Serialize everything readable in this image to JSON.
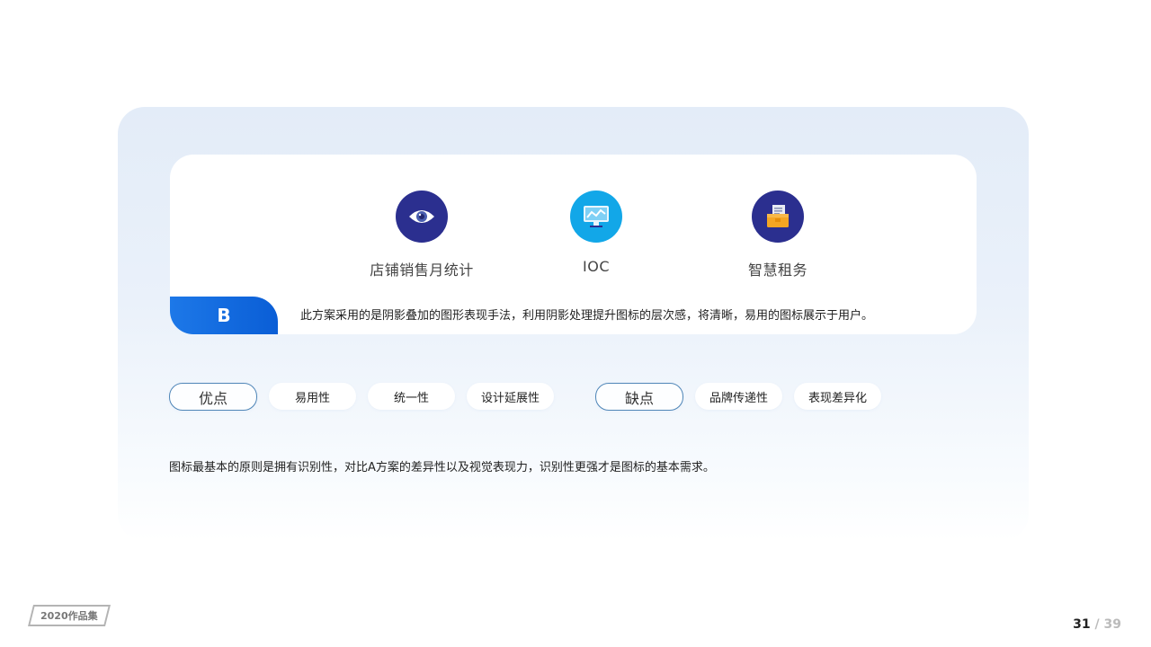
{
  "card": {
    "icons": [
      {
        "label": "店铺销售月统计",
        "icon": "eye-icon",
        "bg": "#2b2f8f"
      },
      {
        "label": "IOC",
        "icon": "monitor-chart-icon",
        "bg": "#12a7e8"
      },
      {
        "label": "智慧租务",
        "icon": "document-folder-icon",
        "bg": "#2b2f8f"
      }
    ],
    "badge": "B",
    "description": "此方案采用的是阴影叠加的图形表现手法，利用阴影处理提升图标的层次感，将清晰，易用的图标展示于用户。"
  },
  "pros": {
    "title": "优点",
    "items": [
      "易用性",
      "统一性",
      "设计延展性"
    ]
  },
  "cons": {
    "title": "缺点",
    "items": [
      "品牌传递性",
      "表现差异化"
    ]
  },
  "summary": "图标最基本的原则是拥有识别性，对比A方案的差异性以及视觉表现力，识别性更强才是图标的基本需求。",
  "footer": {
    "tag": "2020作品集",
    "page_current": "31",
    "page_separator": "/",
    "page_total": "39"
  },
  "colors": {
    "accent": "#1d78e8",
    "navy": "#2b2f8f",
    "cyan": "#12a7e8",
    "outline": "#4f86b8"
  }
}
